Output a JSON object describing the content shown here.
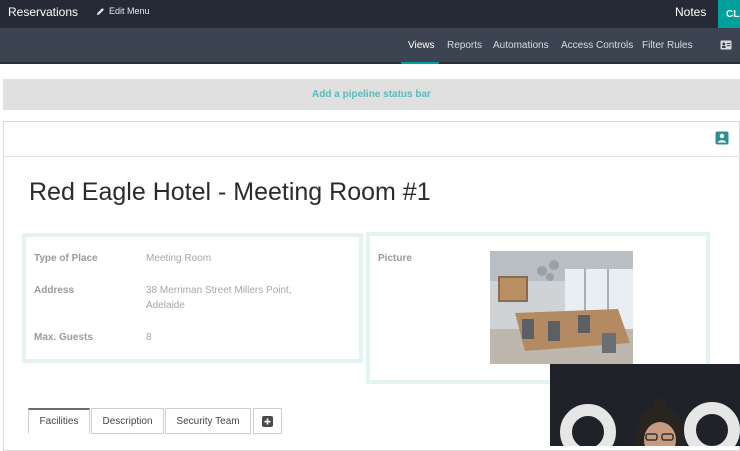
{
  "topbar": {
    "app_name": "Reservations",
    "edit_menu_label": "Edit Menu",
    "edit_icon": "pencil-icon",
    "notes_label": "Notes",
    "corner_button_label": "CL",
    "accent_color": "#00a09d"
  },
  "studio": {
    "tabs": [
      {
        "label": "Views",
        "active": true
      },
      {
        "label": "Reports"
      },
      {
        "label": "Automations"
      },
      {
        "label": "Access Controls"
      },
      {
        "label": "Filter Rules"
      }
    ],
    "card_icon": "id-card-icon"
  },
  "pipeline": {
    "label": "Add a pipeline status bar"
  },
  "form": {
    "title": "Red Eagle Hotel - Meeting Room #1",
    "avatar_button_icon": "avatar-add-icon",
    "fields": [
      {
        "label": "Type of Place",
        "value": "Meeting Room"
      },
      {
        "label": "Address",
        "value_line1": "38 Merriman Street Millers Point,",
        "value_line2": "Adelaide"
      },
      {
        "label": "Max. Guests",
        "value": "8"
      }
    ],
    "picture_label": "Picture",
    "tabs": [
      {
        "label": "Facilities",
        "active": true
      },
      {
        "label": "Description"
      },
      {
        "label": "Security Team"
      }
    ],
    "add_tab_icon": "plus-square-icon"
  }
}
